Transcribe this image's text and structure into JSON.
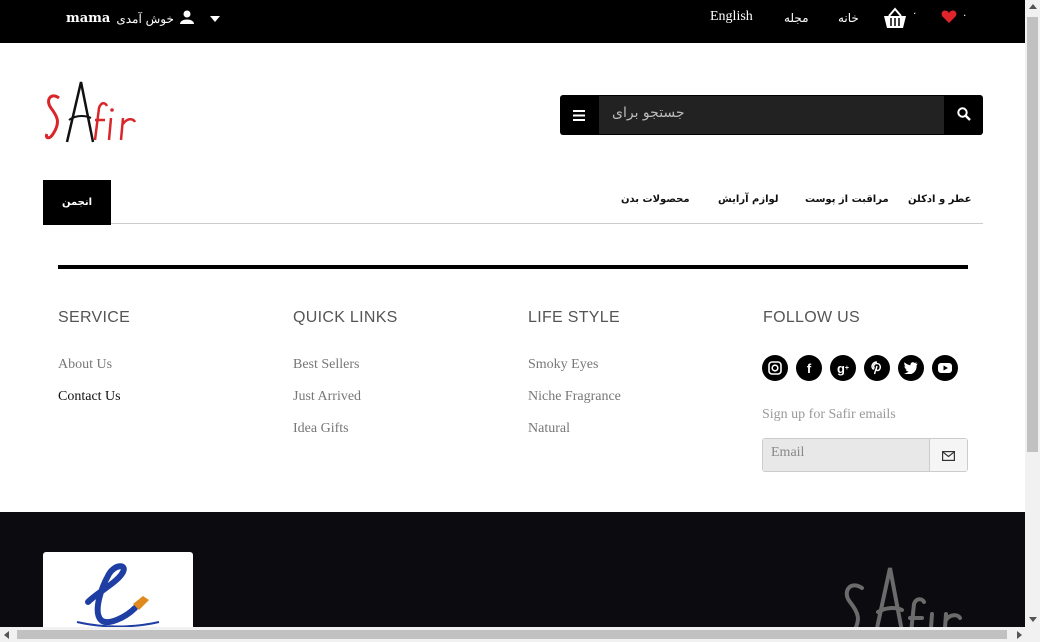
{
  "topbar": {
    "welcome": "خوش آمدی",
    "username": "mama",
    "language": "English",
    "magazine": "مجله",
    "home": "خانه",
    "cart_count": "۰",
    "wishlist_count": "۰"
  },
  "header": {
    "logo_text": "SAfir",
    "search_placeholder": "جستجو برای"
  },
  "catnav": {
    "community": "انجمن",
    "items": [
      "عطر و ادکلن",
      "مراقبت از پوست",
      "لوازم آرایش",
      "محصولات بدن"
    ]
  },
  "footer": {
    "service": {
      "title": "SERVICE",
      "links": [
        "About Us",
        "Contact Us"
      ]
    },
    "quick_links": {
      "title": "QUICK LINKS",
      "links": [
        "Best Sellers",
        "Just Arrived",
        "Idea Gifts"
      ]
    },
    "life_style": {
      "title": "LIFE STYLE",
      "links": [
        "Smoky Eyes",
        "Niche Fragrance",
        "Natural"
      ]
    },
    "follow_us": {
      "title": "FOLLOW US",
      "icons": [
        "instagram-icon",
        "facebook-icon",
        "google-plus-icon",
        "pinterest-icon",
        "twitter-icon",
        "youtube-icon"
      ],
      "signup_text": "Sign up for Safir emails",
      "email_placeholder": "Email"
    }
  },
  "colors": {
    "topbar_bg": "#000000",
    "logo_red": "#d9262b",
    "heart_red": "#e0242c",
    "footer_dark": "#0b0b10"
  }
}
